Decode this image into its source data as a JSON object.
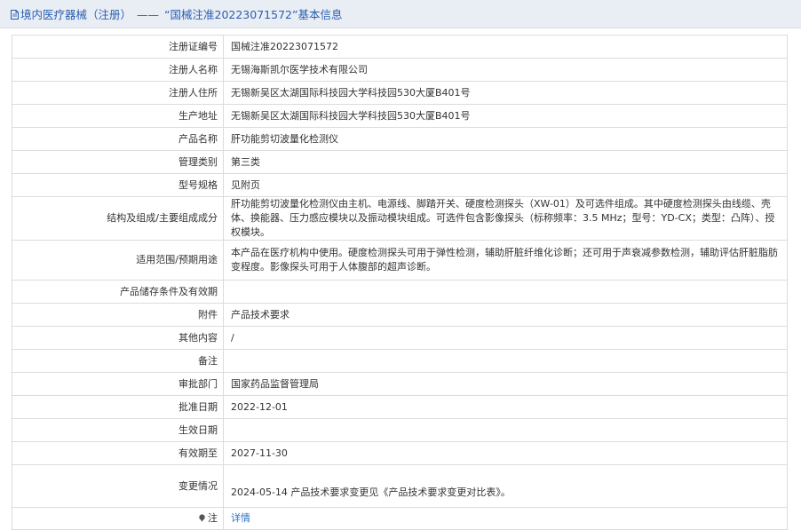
{
  "header": {
    "category": "境内医疗器械（注册）",
    "separator": "——",
    "title": "“国械注准20223071572”基本信息"
  },
  "fields": [
    {
      "label": "注册证编号",
      "value": "国械注准20223071572"
    },
    {
      "label": "注册人名称",
      "value": "无锡海斯凯尔医学技术有限公司"
    },
    {
      "label": "注册人住所",
      "value": "无锡新吴区太湖国际科技园大学科技园530大厦B401号"
    },
    {
      "label": "生产地址",
      "value": "无锡新吴区太湖国际科技园大学科技园530大厦B401号"
    },
    {
      "label": "产品名称",
      "value": "肝功能剪切波量化检测仪"
    },
    {
      "label": "管理类别",
      "value": "第三类"
    },
    {
      "label": "型号规格",
      "value": "见附页"
    },
    {
      "label": "结构及组成/主要组成成分",
      "value": "肝功能剪切波量化检测仪由主机、电源线、脚踏开关、硬度检测探头（XW-01）及可选件组成。其中硬度检测探头由线缆、壳体、换能器、压力感应模块以及振动模块组成。可选件包含影像探头（标称频率：3.5 MHz；型号：YD-CX；类型：凸阵）、授权模块。"
    },
    {
      "label": "适用范围/预期用途",
      "value": "本产品在医疗机构中使用。硬度检测探头可用于弹性检测，辅助肝脏纤维化诊断；还可用于声衰减参数检测，辅助评估肝脏脂肪变程度。影像探头可用于人体腹部的超声诊断。"
    },
    {
      "label": "产品储存条件及有效期",
      "value": ""
    },
    {
      "label": "附件",
      "value": "产品技术要求"
    },
    {
      "label": "其他内容",
      "value": "/"
    },
    {
      "label": "备注",
      "value": ""
    },
    {
      "label": "审批部门",
      "value": "国家药品监督管理局"
    },
    {
      "label": "批准日期",
      "value": "2022-12-01"
    },
    {
      "label": "生效日期",
      "value": ""
    },
    {
      "label": "有效期至",
      "value": "2027-11-30"
    },
    {
      "label": "变更情况",
      "value": "2024-05-14 产品技术要求变更见《产品技术要求变更对比表》。"
    }
  ],
  "note": {
    "label": "注",
    "link_text": "详情"
  },
  "colors": {
    "header_bg": "#e9eef5",
    "header_text": "#2a5db0",
    "link": "#2a6fc9",
    "border": "#dcdcdc"
  }
}
